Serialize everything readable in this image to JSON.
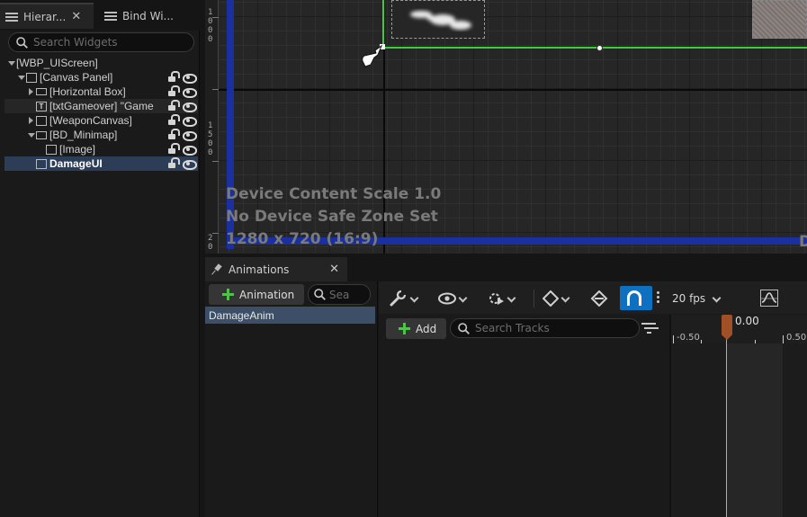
{
  "hierarchy": {
    "tabs": [
      {
        "label": "Hierar...",
        "close": "✕"
      },
      {
        "label": "Bind Wi..."
      }
    ],
    "search_placeholder": "Search Widgets",
    "tree": [
      {
        "label": "[WBP_UIScreen]",
        "depth": 0,
        "expand": "down",
        "icon": ""
      },
      {
        "label": "[Canvas Panel]",
        "depth": 1,
        "expand": "down",
        "icon": "canvas-panel-icon"
      },
      {
        "label": "[Horizontal Box]",
        "depth": 2,
        "expand": "right",
        "icon": "horizontal-box-icon"
      },
      {
        "label": "[txtGameover] \"Game",
        "depth": 2,
        "expand": "none",
        "icon": "text-widget-icon"
      },
      {
        "label": "[WeaponCanvas]",
        "depth": 2,
        "expand": "right",
        "icon": "canvas-panel-icon"
      },
      {
        "label": "[BD_Minimap]",
        "depth": 2,
        "expand": "down",
        "icon": "border-widget-icon"
      },
      {
        "label": "[Image]",
        "depth": 3,
        "expand": "none",
        "icon": "image-widget-icon"
      },
      {
        "label": "DamageUI",
        "depth": 2,
        "expand": "none",
        "icon": "user-widget-icon"
      }
    ]
  },
  "viewport": {
    "ruler_labels": [
      "1\n0\n0\n0",
      "1\n5\n0\n0",
      "2\n0"
    ],
    "info": [
      "Device Content Scale 1.0",
      "No Device Safe Zone Set",
      "1280 x 720 (16:9)"
    ],
    "right_edge_text": "D",
    "colors": {
      "safe_zone": "#1a2fa0",
      "selection": "#36d13a"
    }
  },
  "animations": {
    "tab_title": "Animations",
    "tab_close": "✕",
    "add_animation_label": "Animation",
    "search_placeholder": "Sea",
    "items": [
      "DamageAnim"
    ]
  },
  "sequencer": {
    "fps": "20 fps",
    "add_label": "Add",
    "track_search_placeholder": "Search Tracks",
    "timeline": {
      "labels": [
        "-0.50",
        "0.50"
      ],
      "playhead": "0.00",
      "playhead_color": "#a14f26"
    },
    "snap_color": "#0e70c0"
  }
}
